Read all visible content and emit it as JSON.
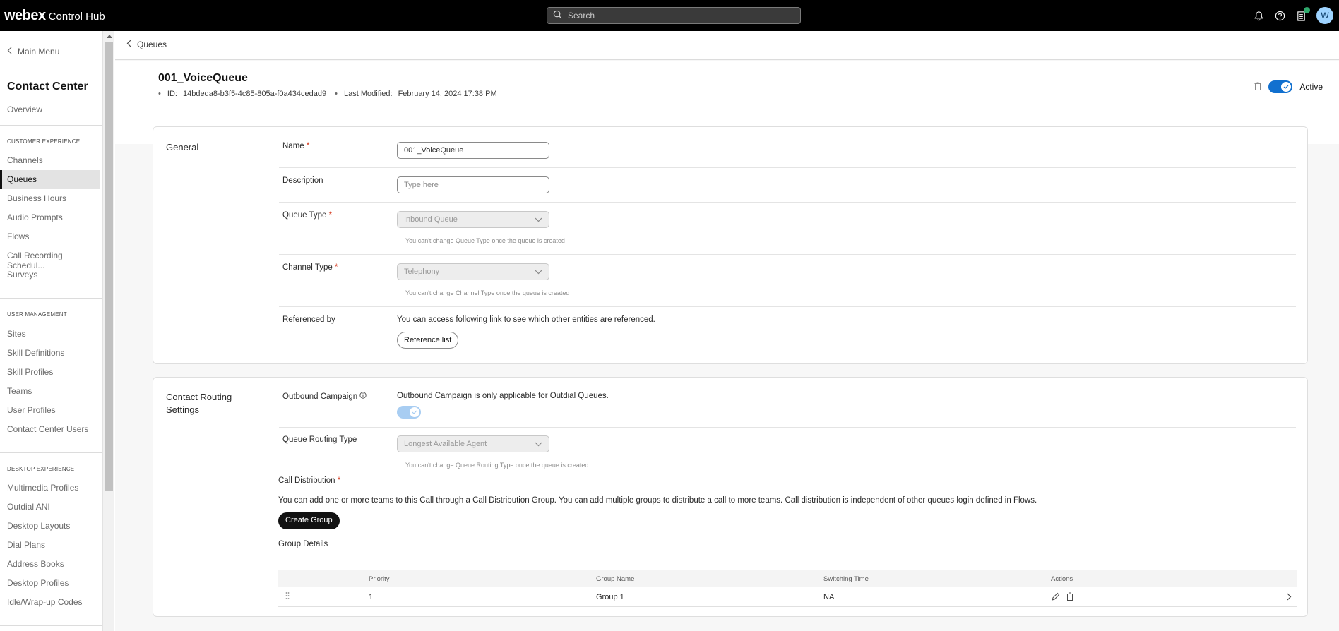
{
  "topbar": {
    "brand": "webex",
    "product": "Control Hub",
    "search_placeholder": "Search",
    "avatar_initial": "W"
  },
  "sidebar": {
    "main_menu": "Main Menu",
    "title": "Contact Center",
    "overview": "Overview",
    "sections": [
      {
        "heading": "CUSTOMER EXPERIENCE",
        "items": [
          "Channels",
          "Queues",
          "Business Hours",
          "Audio Prompts",
          "Flows",
          "Call Recording Schedul...",
          "Surveys"
        ]
      },
      {
        "heading": "USER MANAGEMENT",
        "items": [
          "Sites",
          "Skill Definitions",
          "Skill Profiles",
          "Teams",
          "User Profiles",
          "Contact Center Users"
        ]
      },
      {
        "heading": "DESKTOP EXPERIENCE",
        "items": [
          "Multimedia Profiles",
          "Outdial ANI",
          "Desktop Layouts",
          "Dial Plans",
          "Address Books",
          "Desktop Profiles",
          "Idle/Wrap-up Codes"
        ]
      }
    ],
    "active_item": "Queues"
  },
  "breadcrumb": {
    "back_label": "Queues"
  },
  "queue": {
    "title": "001_VoiceQueue",
    "id_label": "ID:",
    "id_value": "14bdeda8-b3f5-4c85-805a-f0a434cedad9",
    "modified_label": "Last Modified:",
    "modified_value": "February 14, 2024 17:38 PM",
    "status_label": "Active",
    "status_on": true
  },
  "general": {
    "section_title": "General",
    "name_label": "Name",
    "name_value": "001_VoiceQueue",
    "description_label": "Description",
    "description_placeholder": "Type here",
    "queue_type_label": "Queue Type",
    "queue_type_value": "Inbound Queue",
    "queue_type_hint": "You can't change Queue Type once the queue is created",
    "channel_type_label": "Channel Type",
    "channel_type_value": "Telephony",
    "channel_type_hint": "You can't change Channel Type once the queue is created",
    "referenced_label": "Referenced by",
    "referenced_text": "You can access following link to see which other entities are referenced.",
    "reference_button": "Reference list"
  },
  "routing": {
    "section_title_line1": "Contact Routing",
    "section_title_line2": "Settings",
    "outbound_label": "Outbound Campaign",
    "outbound_text": "Outbound Campaign is only applicable for Outdial Queues.",
    "routing_type_label": "Queue Routing Type",
    "routing_type_value": "Longest Available Agent",
    "routing_type_hint": "You can't change Queue Routing Type once the queue is created",
    "call_distribution_label": "Call Distribution",
    "call_distribution_text": "You can add one or more teams to this Call through a Call Distribution Group. You can add multiple groups to distribute a call to more teams. Call distribution is independent of other queues login defined in Flows.",
    "create_group_button": "Create Group",
    "group_details_label": "Group Details",
    "table": {
      "headers": [
        "Priority",
        "Group Name",
        "Switching Time",
        "Actions"
      ],
      "rows": [
        {
          "priority": "1",
          "group_name": "Group 1",
          "switching_time": "NA"
        }
      ]
    }
  },
  "colors": {
    "topbar": "#000000",
    "accent_blue": "#1170cf",
    "required": "#d4371c"
  }
}
